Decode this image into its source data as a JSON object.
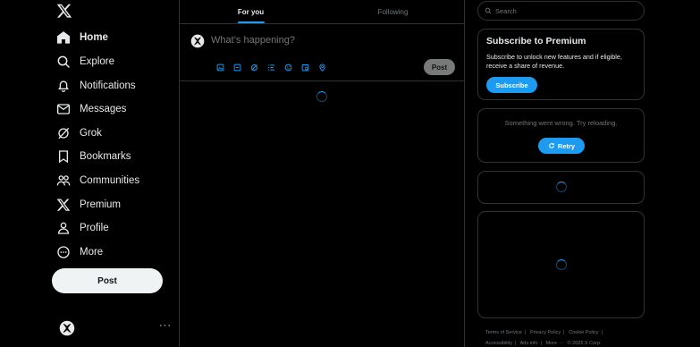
{
  "sidebar": {
    "logo": "x-logo",
    "items": [
      {
        "label": "Home",
        "icon": "home-icon",
        "active": true
      },
      {
        "label": "Explore",
        "icon": "search-icon"
      },
      {
        "label": "Notifications",
        "icon": "bell-icon"
      },
      {
        "label": "Messages",
        "icon": "envelope-icon"
      },
      {
        "label": "Grok",
        "icon": "grok-icon"
      },
      {
        "label": "Bookmarks",
        "icon": "bookmark-icon"
      },
      {
        "label": "Communities",
        "icon": "people-icon"
      },
      {
        "label": "Premium",
        "icon": "x-logo-icon"
      },
      {
        "label": "Profile",
        "icon": "person-icon"
      },
      {
        "label": "More",
        "icon": "more-circle-icon"
      }
    ],
    "post_label": "Post",
    "account_more": "···"
  },
  "main": {
    "tabs": [
      {
        "label": "For you",
        "active": true
      },
      {
        "label": "Following",
        "active": false
      }
    ],
    "composer": {
      "placeholder": "What’s happening?",
      "post_label": "Post",
      "tools": [
        "image-icon",
        "gif-icon",
        "grok-tool-icon",
        "poll-icon",
        "emoji-icon",
        "schedule-icon",
        "location-icon"
      ]
    }
  },
  "right": {
    "search_placeholder": "Search",
    "premium": {
      "title": "Subscribe to Premium",
      "text": "Subscribe to unlock new features and if eligible, receive a share of revenue.",
      "button": "Subscribe"
    },
    "error": {
      "text": "Something went wrong. Try reloading.",
      "retry": "Retry"
    },
    "footer": [
      "Terms of Service",
      "|",
      "Privacy Policy",
      "|",
      "Cookie Policy",
      "|",
      "Accessibility",
      "|",
      "Ads info",
      "|",
      "More ···",
      "© 2025 X Corp."
    ]
  },
  "colors": {
    "accent": "#1d9bf0",
    "background": "#000000",
    "border": "#2f3336",
    "muted_text": "#71767b"
  }
}
